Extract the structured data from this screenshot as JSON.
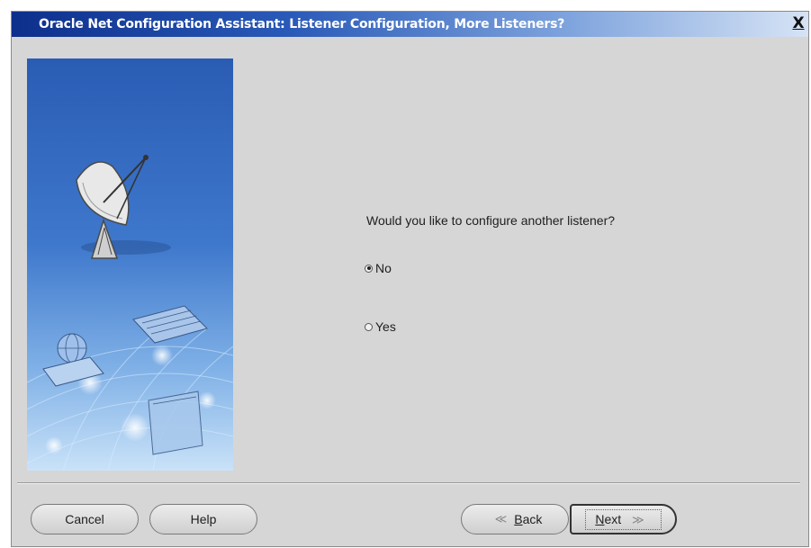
{
  "window": {
    "title": "Oracle Net Configuration Assistant: Listener Configuration, More Listeners?",
    "close_label": "X"
  },
  "main": {
    "question": "Would you like to configure another listener?",
    "options": [
      {
        "label": "No",
        "selected": true
      },
      {
        "label": "Yes",
        "selected": false
      }
    ]
  },
  "buttons": {
    "cancel": "Cancel",
    "help": "Help",
    "back": {
      "mnemonic": "B",
      "rest": "ack",
      "arrow": "≪"
    },
    "next": {
      "mnemonic": "N",
      "rest": "ext",
      "arrow": "≫"
    }
  },
  "icons": {
    "panel": [
      "satellite-dish-icon",
      "keyboard-icon",
      "globe-icon",
      "folder-icon"
    ]
  },
  "colors": {
    "titlebar_start": "#0d2f8c",
    "window_bg": "#d6d6d6",
    "panel_blue": "#3b6fc2"
  }
}
